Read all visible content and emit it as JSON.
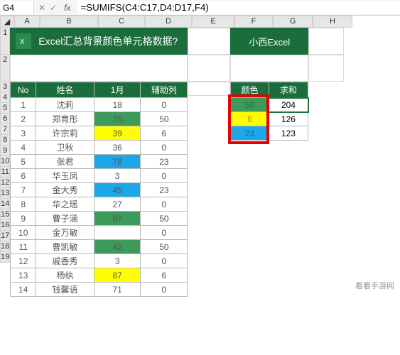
{
  "cell_reference": "G4",
  "formula": "=SUMIFS(C4:C17,D4:D17,F4)",
  "columns": [
    "A",
    "B",
    "C",
    "D",
    "E",
    "F",
    "G",
    "H"
  ],
  "row_numbers": [
    1,
    2,
    3,
    4,
    5,
    6,
    7,
    8,
    9,
    10,
    11,
    12,
    13,
    14,
    15,
    16,
    17,
    18,
    19
  ],
  "title": "Excel汇总背景颜色单元格数据?",
  "subtitle": "小西Excel",
  "main_headers": {
    "no": "No",
    "name": "姓名",
    "month": "1月",
    "aux": "辅助列"
  },
  "main_rows": [
    {
      "no": 1,
      "name": "沈莉",
      "val": "18",
      "color": "",
      "aux": 0
    },
    {
      "no": 2,
      "name": "郑育彤",
      "val": "75",
      "color": "green",
      "aux": 50
    },
    {
      "no": 3,
      "name": "许宗莉",
      "val": "39",
      "color": "yellow",
      "aux": 6
    },
    {
      "no": 4,
      "name": "卫秋",
      "val": "36",
      "color": "",
      "aux": 0
    },
    {
      "no": 5,
      "name": "张君",
      "val": "78",
      "color": "blue",
      "aux": 23
    },
    {
      "no": 6,
      "name": "华玉凤",
      "val": "3",
      "color": "",
      "aux": 0
    },
    {
      "no": 7,
      "name": "金大秀",
      "val": "45",
      "color": "blue",
      "aux": 23
    },
    {
      "no": 8,
      "name": "华之瑶",
      "val": "27",
      "color": "",
      "aux": 0
    },
    {
      "no": 9,
      "name": "曹子涵",
      "val": "87",
      "color": "green",
      "aux": 50
    },
    {
      "no": 10,
      "name": "金万敏",
      "val": "",
      "color": "",
      "aux": 0
    },
    {
      "no": 11,
      "name": "曹凯敏",
      "val": "42",
      "color": "green",
      "aux": 50
    },
    {
      "no": 12,
      "name": "戚香秀",
      "val": "3",
      "color": "",
      "aux": 0
    },
    {
      "no": 13,
      "name": "杨纨",
      "val": "87",
      "color": "yellow",
      "aux": 6
    },
    {
      "no": 14,
      "name": "钱馨语",
      "val": "71",
      "color": "",
      "aux": 0
    }
  ],
  "sum_headers": {
    "color": "颜色",
    "sum": "求和"
  },
  "sum_rows": [
    {
      "val": "50",
      "color": "green",
      "sum": 204
    },
    {
      "val": "6",
      "color": "yellow",
      "sum": 126
    },
    {
      "val": "23",
      "color": "blue",
      "sum": 123
    }
  ],
  "watermark": "看看手游网"
}
